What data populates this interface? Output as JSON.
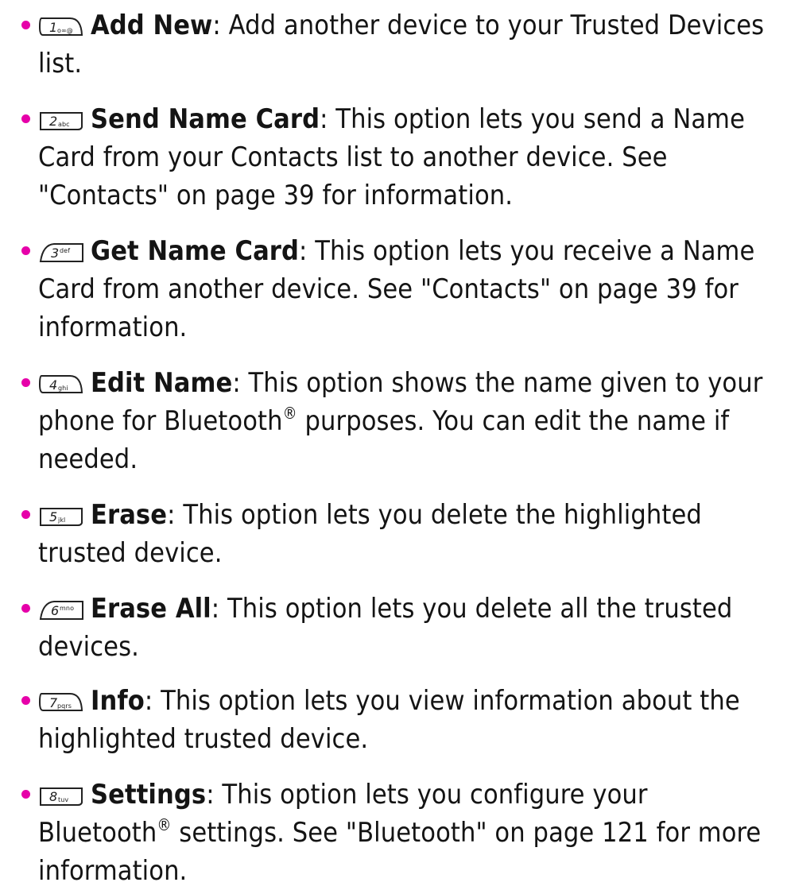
{
  "items": [
    {
      "key": "1",
      "key_sub": "o∞@",
      "term": "Add New",
      "desc_a": ": Add another device to your Trusted Devices list.",
      "desc_b": ""
    },
    {
      "key": "2",
      "key_sub": "abc",
      "term": "Send Name Card",
      "desc_a": ": This option lets you send a Name Card from your Contacts list to another device. See \"Contacts\" on page 39 for information.",
      "desc_b": ""
    },
    {
      "key": "3",
      "key_sub": "def",
      "term": "Get Name Card",
      "desc_a": ": This option lets you receive a Name Card from another device. See \"Contacts\" on page 39 for information.",
      "desc_b": ""
    },
    {
      "key": "4",
      "key_sub": "ghi",
      "term": "Edit Name",
      "desc_a": ": This option shows the name given to your phone for Bluetooth",
      "desc_b": " purposes. You can edit the name if needed."
    },
    {
      "key": "5",
      "key_sub": "jkl",
      "term": "Erase",
      "desc_a": ": This option lets you delete the highlighted trusted device.",
      "desc_b": ""
    },
    {
      "key": "6",
      "key_sub": "mno",
      "term": "Erase All",
      "desc_a": ": This option lets you delete all the trusted devices.",
      "desc_b": ""
    },
    {
      "key": "7",
      "key_sub": "pqrs",
      "term": "Info",
      "desc_a": ": This option lets you view information about the highlighted trusted device.",
      "desc_b": ""
    },
    {
      "key": "8",
      "key_sub": "tuv",
      "term": "Settings",
      "desc_a": ": This option lets you configure your Bluetooth",
      "desc_b": " settings. See \"Bluetooth\" on page 121 for more information."
    }
  ],
  "registered_mark": "®",
  "bullet_color": "#e600a9",
  "key_icon": "keypad-key-icon"
}
